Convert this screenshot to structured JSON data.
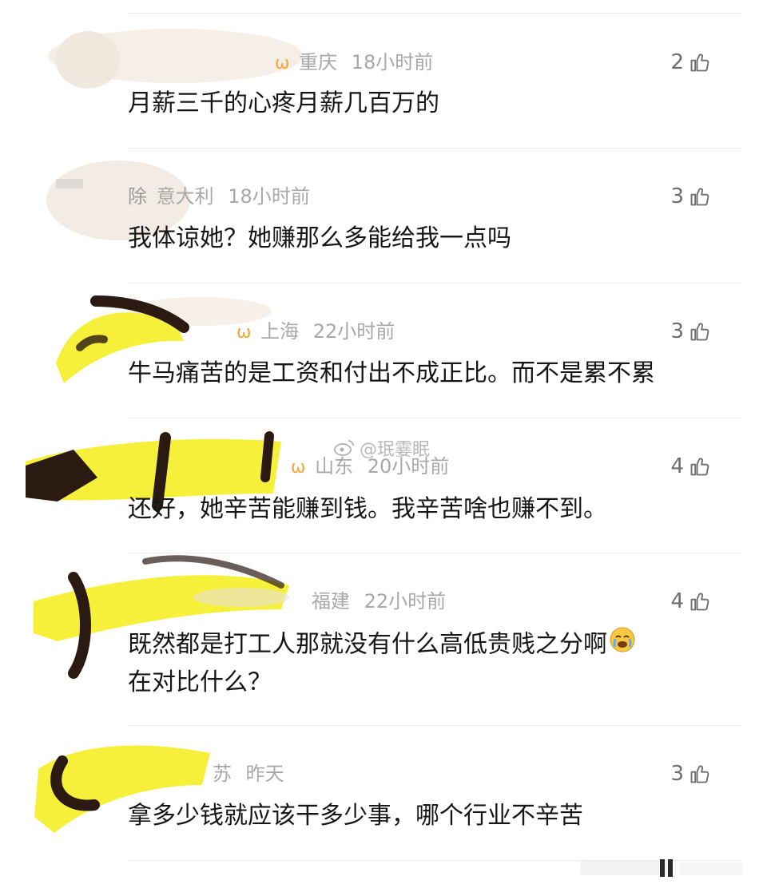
{
  "watermark": {
    "text": "@珉霎眠",
    "icon": "weibo-logo-icon"
  },
  "colors": {
    "avatar_sticker_yellow": "#f7f03a",
    "avatar_sticker_dark": "#2a1a12",
    "meta_grey": "#a8a8a8",
    "text_dark": "#161616",
    "vip_badge": "#f2a43a"
  },
  "comments": [
    {
      "user": "",
      "badge": "vip-badge-icon",
      "location": "重庆",
      "time": "18小时前",
      "likes": "2",
      "text": "月薪三千的心疼月薪几百万的",
      "text2": ""
    },
    {
      "user": "除",
      "badge": "",
      "location": "意大利",
      "time": "18小时前",
      "likes": "3",
      "text": "我体谅她？她赚那么多能给我一点吗",
      "text2": ""
    },
    {
      "user": "",
      "badge": "vip-badge-icon",
      "location": "上海",
      "time": "22小时前",
      "likes": "3",
      "text": "牛马痛苦的是工资和付出不成正比。而不是累不累",
      "text2": ""
    },
    {
      "user": "",
      "badge": "vip-badge-icon",
      "location": "山东",
      "time": "20小时前",
      "likes": "4",
      "text": "还好，她辛苦能赚到钱。我辛苦啥也赚不到。",
      "text2": ""
    },
    {
      "user": "",
      "badge": "",
      "location": "福建",
      "time": "22小时前",
      "likes": "4",
      "text": "既然都是打工人那就没有什么高低贵贱之分啊",
      "text2": "在对比什么？",
      "emoji": "crying-face-icon"
    },
    {
      "user": "",
      "badge": "",
      "location": "苏",
      "time": "昨天",
      "likes": "3",
      "text": "拿多少钱就应该干多少事，哪个行业不辛苦",
      "text2": ""
    }
  ]
}
